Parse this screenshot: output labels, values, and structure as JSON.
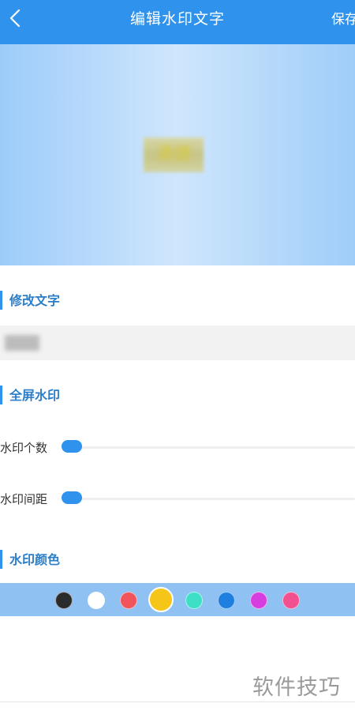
{
  "header": {
    "title": "编辑水印文字",
    "save_label": "保存"
  },
  "preview": {
    "watermark_text": "清捷"
  },
  "sections": {
    "modify_text": "修改文字",
    "fullscreen": "全屏水印",
    "color": "水印颜色"
  },
  "text_input": {
    "value": ""
  },
  "sliders": {
    "count_label": "水印个数",
    "count_value": 0,
    "spacing_label": "水印间距",
    "spacing_value": 0
  },
  "colors": {
    "options": [
      "#2b2b2b",
      "#ffffff",
      "#f2545b",
      "#f5c518",
      "#3de0c5",
      "#1f7fe0",
      "#d63ee0",
      "#f2508f"
    ],
    "selected": "#f5c518"
  },
  "site_watermark": "软件技巧"
}
